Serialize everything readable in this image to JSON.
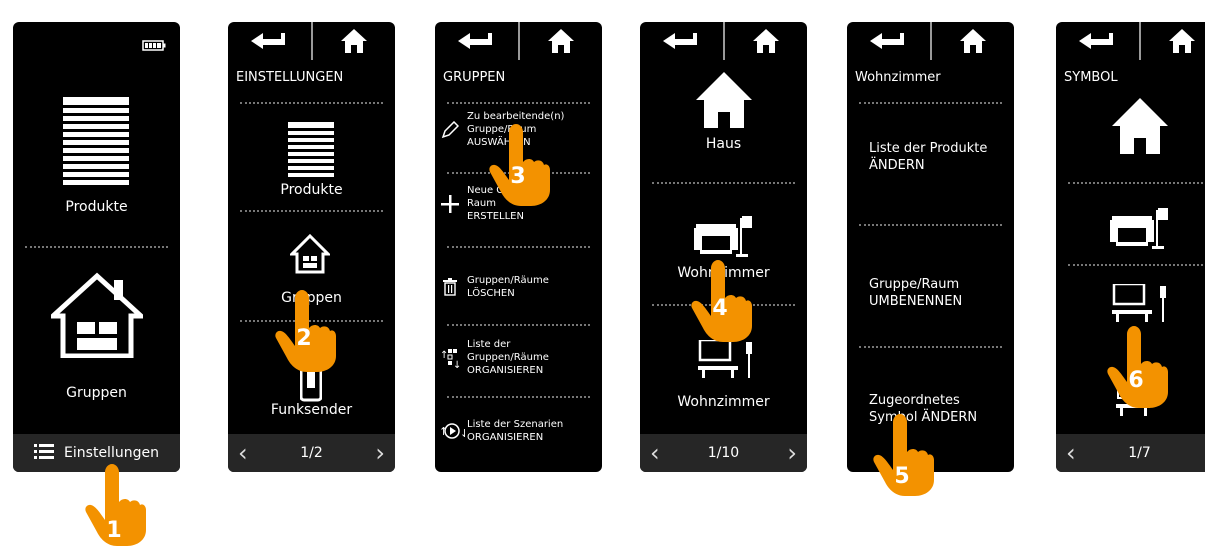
{
  "colors": {
    "accent": "#f39200",
    "screen": "#000000",
    "pager": "#262626"
  },
  "icons": [
    "battery-icon",
    "back-icon",
    "home-icon",
    "blind-icon",
    "house-icon",
    "list-icon",
    "edit-icon",
    "plus-icon",
    "trash-icon",
    "organize-icon",
    "scenario-icon",
    "sofa-icon",
    "desk-icon",
    "hand-pointer-icon"
  ],
  "screen1": {
    "produkte": "Produkte",
    "gruppen": "Gruppen",
    "einstellungen": "Einstellungen"
  },
  "screen2": {
    "title": "EINSTELLUNGEN",
    "produkte": "Produkte",
    "gruppen": "Gruppen",
    "funksender": "Funksender",
    "page": "1/2"
  },
  "screen3": {
    "title": "GRUPPEN",
    "items": [
      {
        "l1": "Zu bearbeitende(n)",
        "l2": "Gruppe/Raum",
        "l3": "AUSWÄHLEN"
      },
      {
        "l1": "Neue Gruppe/",
        "l2": "Raum",
        "l3": "ERSTELLEN"
      },
      {
        "l1": "Gruppen/Räume",
        "l2": "LÖSCHEN",
        "l3": ""
      },
      {
        "l1": "Liste der",
        "l2": "Gruppen/Räume",
        "l3": "ORGANISIEREN"
      },
      {
        "l1": "Liste der Szenarien",
        "l2": "ORGANISIEREN",
        "l3": ""
      }
    ]
  },
  "screen4": {
    "haus": "Haus",
    "wohn1": "Wohnzimmer",
    "wohn2": "Wohnzimmer",
    "page": "1/10"
  },
  "screen5": {
    "title": "Wohnzimmer",
    "opt1_l1": "Liste der Produkte",
    "opt1_l2": "ÄNDERN",
    "opt2_l1": "Gruppe/Raum",
    "opt2_l2": "UMBENENNEN",
    "opt3_l1": "Zugeordnetes",
    "opt3_l2": "Symbol ÄNDERN"
  },
  "screen6": {
    "title": "SYMBOL",
    "page": "1/7"
  },
  "steps": [
    "1",
    "2",
    "3",
    "4",
    "5",
    "6"
  ]
}
